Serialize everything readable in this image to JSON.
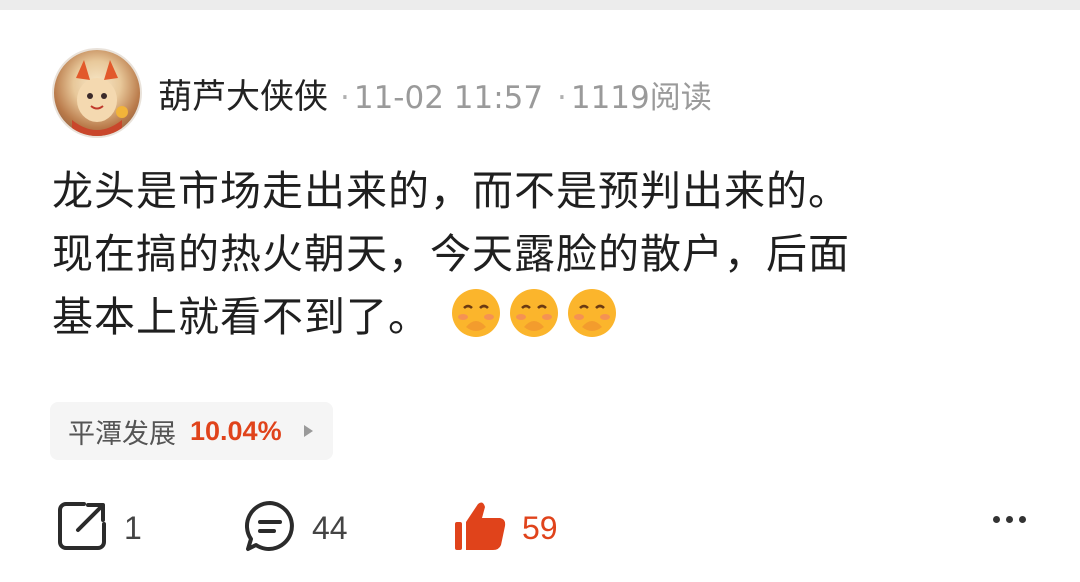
{
  "post": {
    "username": "葫芦大侠侠",
    "datetime": "11-02 11:57",
    "views": "1119阅读",
    "separator": "·",
    "content_lines": [
      "龙头是市场走出来的，而不是预判出来的。",
      "现在搞的热火朝天，今天露脸的散户，后面",
      "基本上就看不到了。"
    ],
    "emoji_icons": [
      "blushing-laugh-emoji",
      "blushing-laugh-emoji",
      "blushing-laugh-emoji"
    ]
  },
  "stock_tag": {
    "name": "平潭发展",
    "change": "10.04%",
    "change_color": "#e0431b"
  },
  "actions": {
    "share": {
      "icon": "share-icon",
      "count": "1"
    },
    "comment": {
      "icon": "comment-icon",
      "count": "44"
    },
    "like": {
      "icon": "thumbs-up-icon",
      "count": "59",
      "color": "#e0431b"
    },
    "more": {
      "icon": "more-dots-icon"
    }
  }
}
